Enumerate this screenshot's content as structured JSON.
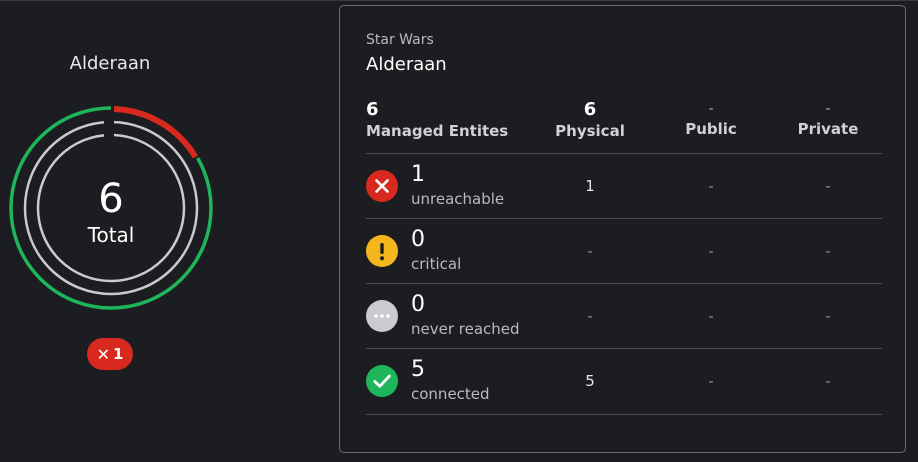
{
  "site": {
    "name": "Alderaan",
    "total_value": "6",
    "total_label": "Total",
    "badge_count": "1",
    "ring_segments": {
      "total": 6,
      "unreachable": 1,
      "connected": 5
    },
    "colors": {
      "connected": "#1fb55a",
      "unreachable": "#d8291e",
      "critical": "#f3b61d",
      "never_reached": "#c9cad2"
    }
  },
  "panel": {
    "org": "Star Wars",
    "site": "Alderaan",
    "headers": {
      "managed": {
        "value": "6",
        "label": "Managed Entites"
      },
      "physical": {
        "value": "6",
        "label": "Physical"
      },
      "public": {
        "value": "-",
        "label": "Public"
      },
      "private": {
        "value": "-",
        "label": "Private"
      }
    },
    "rows": [
      {
        "icon": "error-x-icon",
        "count": "1",
        "label": "unreachable",
        "physical": "1",
        "public": "-",
        "private": "-"
      },
      {
        "icon": "warning-exclamation-icon",
        "count": "0",
        "label": "critical",
        "physical": "-",
        "public": "-",
        "private": "-"
      },
      {
        "icon": "ellipsis-icon",
        "count": "0",
        "label": "never reached",
        "physical": "-",
        "public": "-",
        "private": "-"
      },
      {
        "icon": "checkmark-icon",
        "count": "5",
        "label": "connected",
        "physical": "5",
        "public": "-",
        "private": "-"
      }
    ]
  }
}
